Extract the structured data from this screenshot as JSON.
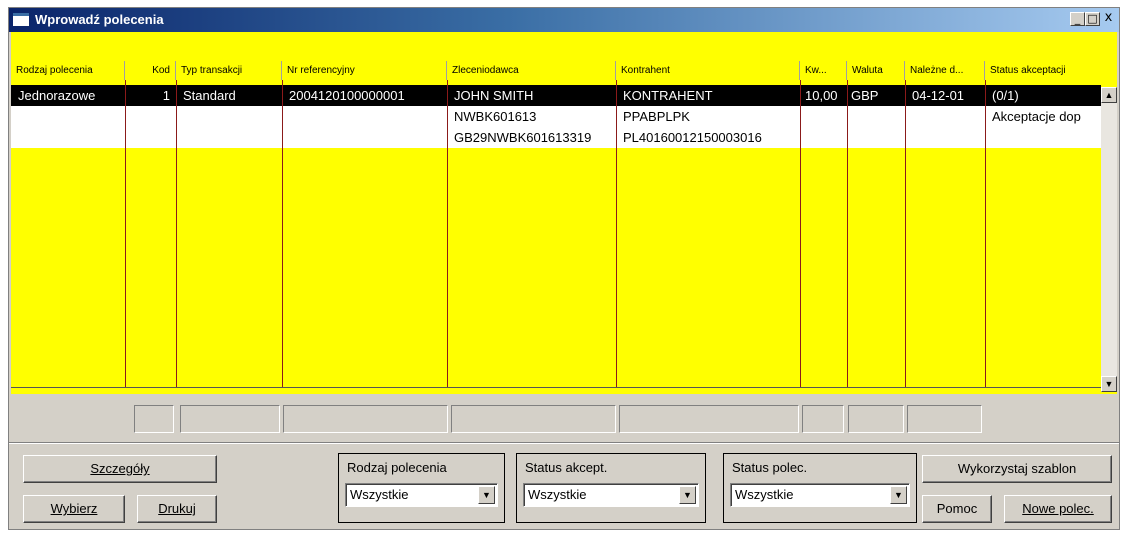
{
  "window": {
    "title": "Wprowadź polecenia",
    "buttons": {
      "minimize": "_",
      "maximize": "□",
      "close": "x"
    }
  },
  "colors": {
    "grid_bg": "#ffff00",
    "selection": "#000000",
    "divider": "#8b1a1a",
    "titlebar": "#0a246a"
  },
  "table": {
    "columns": [
      "Rodzaj polecenia",
      "Kod",
      "Typ transakcji",
      "Nr referencyjny",
      "Zleceniodawca",
      "Kontrahent",
      "Kw...",
      "Waluta",
      "Należne d...",
      "Status akceptacji"
    ],
    "rows": [
      [
        "Jednorazowe",
        "1",
        "Standard",
        "2004120100000001",
        "JOHN SMITH",
        "KONTRAHENT",
        "10,00",
        "GBP",
        "04-12-01",
        "(0/1)"
      ],
      [
        "",
        "",
        "",
        "",
        "NWBK601613",
        "PPABPLPK",
        "",
        "",
        "",
        "Akceptacje dop"
      ],
      [
        "",
        "",
        "",
        "",
        "GB29NWBK601613319",
        "PL40160012150003016",
        "",
        "",
        "",
        ""
      ]
    ],
    "scroll": {
      "up_icon": "▲",
      "down_icon": "▼"
    }
  },
  "buttons": {
    "details": "Szczegóły",
    "select": "Wybierz",
    "print": "Drukuj",
    "use_template": "Wykorzystaj szablon",
    "help": "Pomoc",
    "new_order": "Nowe polec."
  },
  "filters": [
    {
      "label": "Rodzaj polecenia",
      "value": "Wszystkie"
    },
    {
      "label": "Status akcept.",
      "value": "Wszystkie"
    },
    {
      "label": "Status polec.",
      "value": "Wszystkie"
    }
  ],
  "icons": {
    "combo_arrow": "▼"
  }
}
